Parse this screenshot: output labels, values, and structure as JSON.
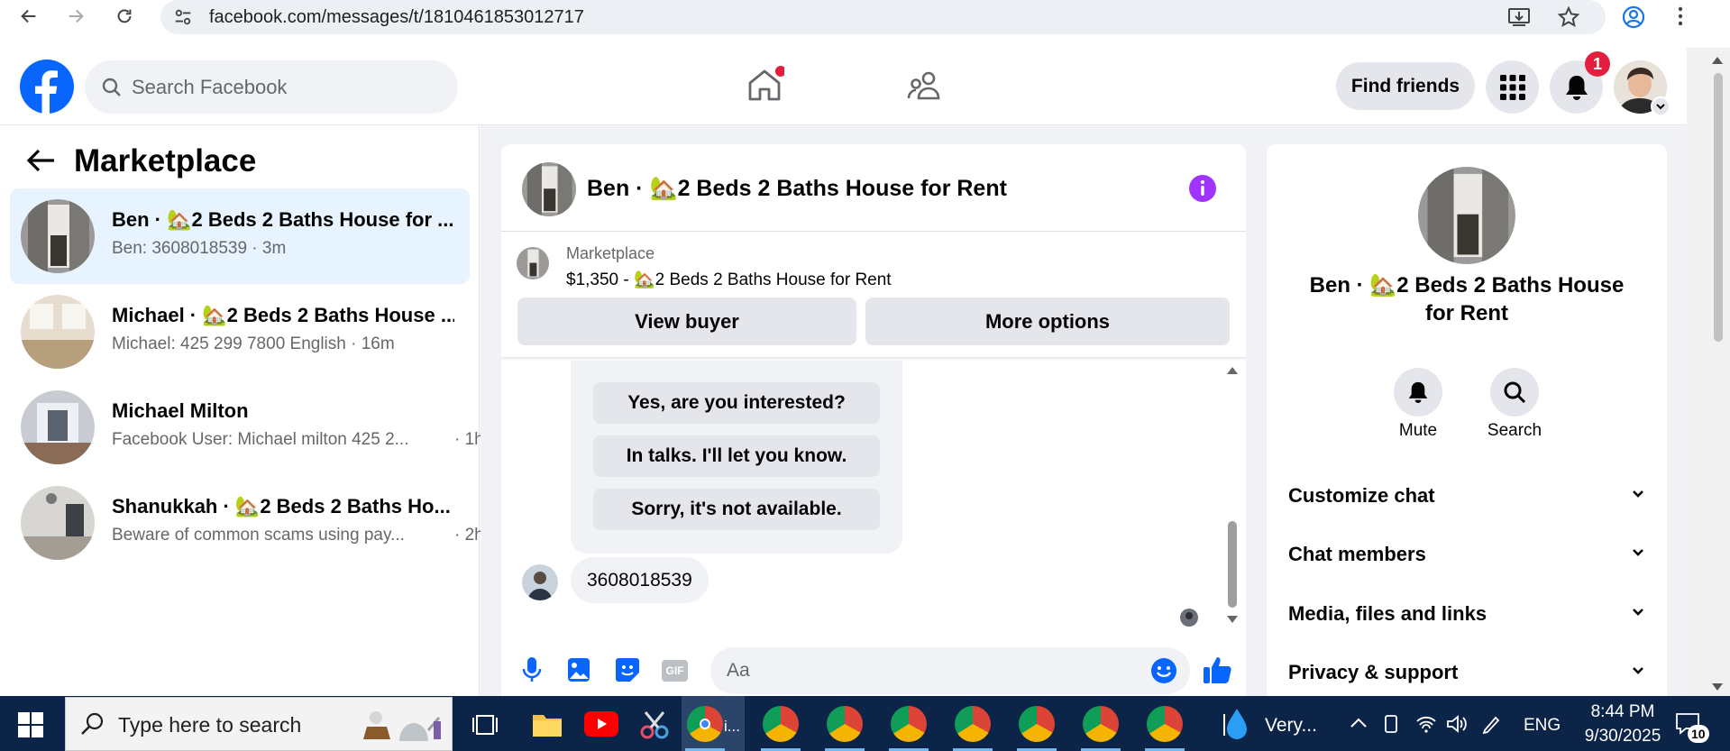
{
  "browser": {
    "url": "facebook.com/messages/t/1810461853012717"
  },
  "header": {
    "search_placeholder": "Search Facebook",
    "find_friends": "Find friends",
    "notification_count": "1"
  },
  "left_panel": {
    "title": "Marketplace",
    "conversations": [
      {
        "name": "Ben · 🏡2 Beds 2 Baths House for ...",
        "preview": "Ben: 3608018539 · 3m",
        "time": ""
      },
      {
        "name": "Michael · 🏡2 Beds 2 Baths House ...",
        "preview": "Michael: 425 299 7800 English · 16m",
        "time": ""
      },
      {
        "name": "Michael Milton",
        "preview": "Facebook User: Michael milton 425 2...",
        "time": "· 1h"
      },
      {
        "name": "Shanukkah · 🏡2 Beds 2 Baths Ho...",
        "preview": "Beware of common scams using pay...",
        "time": "· 2h"
      }
    ]
  },
  "chat": {
    "title": "Ben · 🏡2 Beds 2 Baths House for Rent",
    "listing_source": "Marketplace",
    "listing_title": "$1,350 - 🏡2 Beds 2 Baths House for Rent",
    "view_buyer": "View buyer",
    "more_options": "More options",
    "quick_replies": [
      "Yes, are you interested?",
      "In talks. I'll let you know.",
      "Sorry, it's not available."
    ],
    "message": "3608018539",
    "composer_placeholder": "Aa"
  },
  "right_panel": {
    "title": "Ben · 🏡2 Beds 2 Baths House for Rent",
    "mute": "Mute",
    "search": "Search",
    "sections": [
      "Customize chat",
      "Chat members",
      "Media, files and links",
      "Privacy & support"
    ]
  },
  "taskbar": {
    "search_placeholder": "Type here to search",
    "active_app_label": "i...",
    "weather_label": "Very...",
    "language": "ENG",
    "time": "8:44 PM",
    "date": "9/30/2025",
    "notification_count": "10"
  },
  "colors": {
    "facebook_blue": "#0866ff",
    "active_row": "#e7f3ff",
    "badge_red": "#e41e3f",
    "info_purple": "#a033ff",
    "taskbar": "#0b2447"
  }
}
